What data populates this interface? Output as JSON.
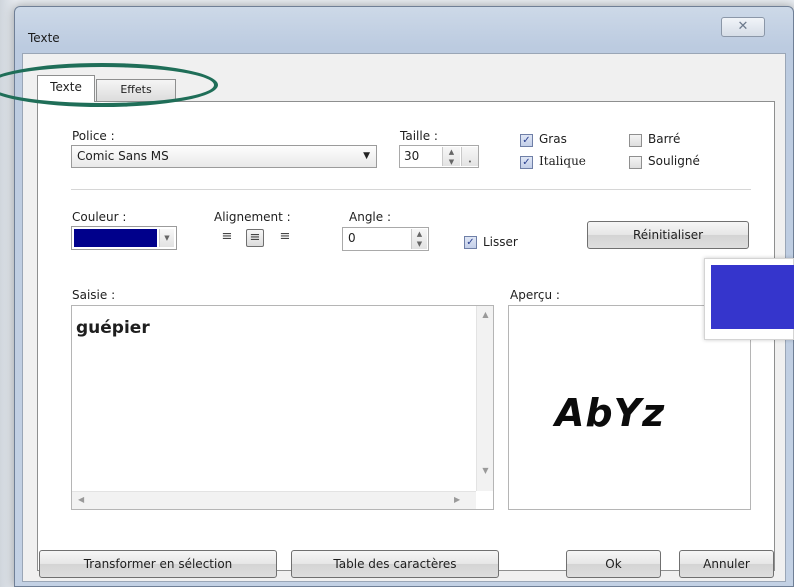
{
  "window": {
    "title": "Texte",
    "close_glyph": "✕"
  },
  "tabs": [
    {
      "label": "Texte"
    },
    {
      "label": "Effets"
    }
  ],
  "font": {
    "label": "Police :",
    "value": "Comic Sans MS"
  },
  "size": {
    "label": "Taille :",
    "value": "30"
  },
  "styles": {
    "bold": {
      "label": "Gras",
      "checked": true
    },
    "italic": {
      "label": "Italique",
      "checked": true
    },
    "strike": {
      "label": "Barré",
      "checked": false
    },
    "underline": {
      "label": "Souligné",
      "checked": false
    }
  },
  "color": {
    "label": "Couleur :",
    "value": "#00008b"
  },
  "alignment": {
    "label": "Alignement :",
    "options": [
      "left",
      "center",
      "right"
    ],
    "selected": "center"
  },
  "angle": {
    "label": "Angle :",
    "value": "0"
  },
  "smooth": {
    "label": "Lisser",
    "checked": true
  },
  "reset_button": "Réinitialiser",
  "input": {
    "label": "Saisie :",
    "value": "guépier"
  },
  "preview": {
    "label": "Aperçu :",
    "sample": "AbYz"
  },
  "overlay_color": "#3535cc",
  "footer": {
    "transform_button": "Transformer en sélection",
    "charmap_button": "Table des caractères",
    "ok_button": "Ok",
    "cancel_button": "Annuler"
  },
  "highlight_color": "#1f6e58"
}
